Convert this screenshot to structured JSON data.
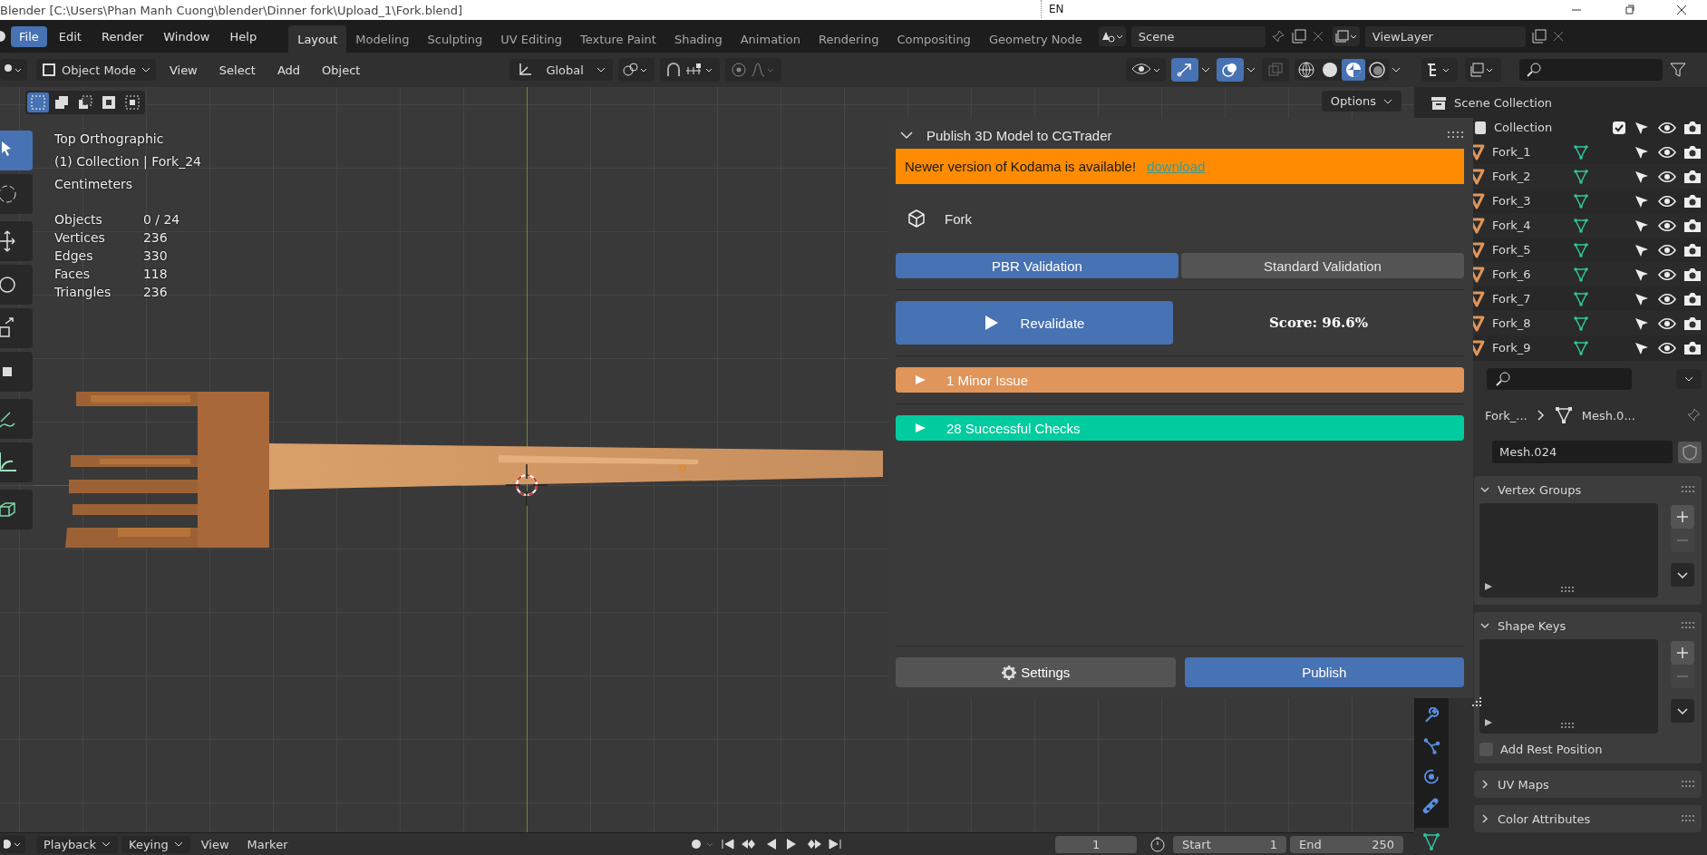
{
  "title_bar": {
    "title": "Blender [C:\\Users\\Phan Manh Cuong\\blender\\Dinner fork\\Upload_1\\Fork.blend]",
    "input_indicator": "EN"
  },
  "menu_bar": {
    "menus": [
      {
        "label": "File",
        "selected": true
      },
      {
        "label": "Edit",
        "selected": false
      },
      {
        "label": "Render",
        "selected": false
      },
      {
        "label": "Window",
        "selected": false
      },
      {
        "label": "Help",
        "selected": false
      }
    ],
    "workspaces": [
      {
        "label": "Layout",
        "selected": true
      },
      {
        "label": "Modeling",
        "selected": false
      },
      {
        "label": "Sculpting",
        "selected": false
      },
      {
        "label": "UV Editing",
        "selected": false
      },
      {
        "label": "Texture Paint",
        "selected": false
      },
      {
        "label": "Shading",
        "selected": false
      },
      {
        "label": "Animation",
        "selected": false
      },
      {
        "label": "Rendering",
        "selected": false
      },
      {
        "label": "Compositing",
        "selected": false
      },
      {
        "label": "Geometry Node",
        "selected": false
      }
    ],
    "scene": "Scene",
    "view_layer": "ViewLayer"
  },
  "viewport_header": {
    "mode": "Object Mode",
    "menus": [
      "View",
      "Select",
      "Add",
      "Object"
    ],
    "orientation": "Global",
    "options": "Options",
    "gizmos_on": true,
    "overlays_on": true,
    "shading_modes": [
      {
        "selected": false
      },
      {
        "selected": false
      },
      {
        "selected": true
      },
      {
        "selected": false
      }
    ]
  },
  "viewport_toolbar": [
    {
      "selected": true
    },
    {
      "selected": false
    },
    {
      "selected": false
    },
    {
      "selected": false
    },
    {
      "selected": false
    },
    {
      "selected": false
    },
    {
      "selected": false
    },
    {
      "selected": false
    },
    {
      "selected": false
    }
  ],
  "selection_modes": [
    {
      "selected": true
    },
    {
      "selected": false
    },
    {
      "selected": false
    },
    {
      "selected": false
    },
    {
      "selected": false
    }
  ],
  "viewport_overlay": {
    "view": "Top Orthographic",
    "context": "(1) Collection | Fork_24",
    "units": "Centimeters",
    "stats": [
      {
        "label": "Objects",
        "value": "0 / 24"
      },
      {
        "label": "Vertices",
        "value": "236"
      },
      {
        "label": "Edges",
        "value": "330"
      },
      {
        "label": "Faces",
        "value": "118"
      },
      {
        "label": "Triangles",
        "value": "236"
      }
    ]
  },
  "addon_panel": {
    "title": "Publish 3D Model to CGTrader",
    "notice": "Newer version of Kodama is available!",
    "notice_link": "download",
    "model_name": "Fork",
    "validation_tabs": [
      {
        "label": "PBR Validation",
        "selected": true
      },
      {
        "label": "Standard Validation",
        "selected": false
      }
    ],
    "revalidate": "Revalidate",
    "score": "Score: 96.6%",
    "results": [
      {
        "label": "1 Minor Issue",
        "kind": "warning"
      },
      {
        "label": "28 Successful Checks",
        "kind": "success"
      }
    ],
    "settings": "Settings",
    "publish": "Publish"
  },
  "outliner": {
    "root": "Scene Collection",
    "collection": {
      "label": "Collection",
      "checked": true
    },
    "items": [
      "Fork_1",
      "Fork_2",
      "Fork_3",
      "Fork_4",
      "Fork_5",
      "Fork_6",
      "Fork_7",
      "Fork_8",
      "Fork_9"
    ]
  },
  "properties": {
    "breadcrumb": [
      "Fork_...",
      "Mesh.0..."
    ],
    "mesh_name": "Mesh.024",
    "sections": [
      {
        "title": "Vertex Groups",
        "expanded": true
      },
      {
        "title": "Shape Keys",
        "expanded": true,
        "option": {
          "label": "Add Rest Position",
          "checked": false
        }
      },
      {
        "title": "UV Maps",
        "expanded": false
      },
      {
        "title": "Color Attributes",
        "expanded": false
      }
    ]
  },
  "timeline": {
    "menus": [
      "Playback",
      "Keying",
      "View",
      "Marker"
    ],
    "current_frame": "1",
    "start_label": "Start",
    "start": "1",
    "end_label": "End",
    "end": "250"
  }
}
